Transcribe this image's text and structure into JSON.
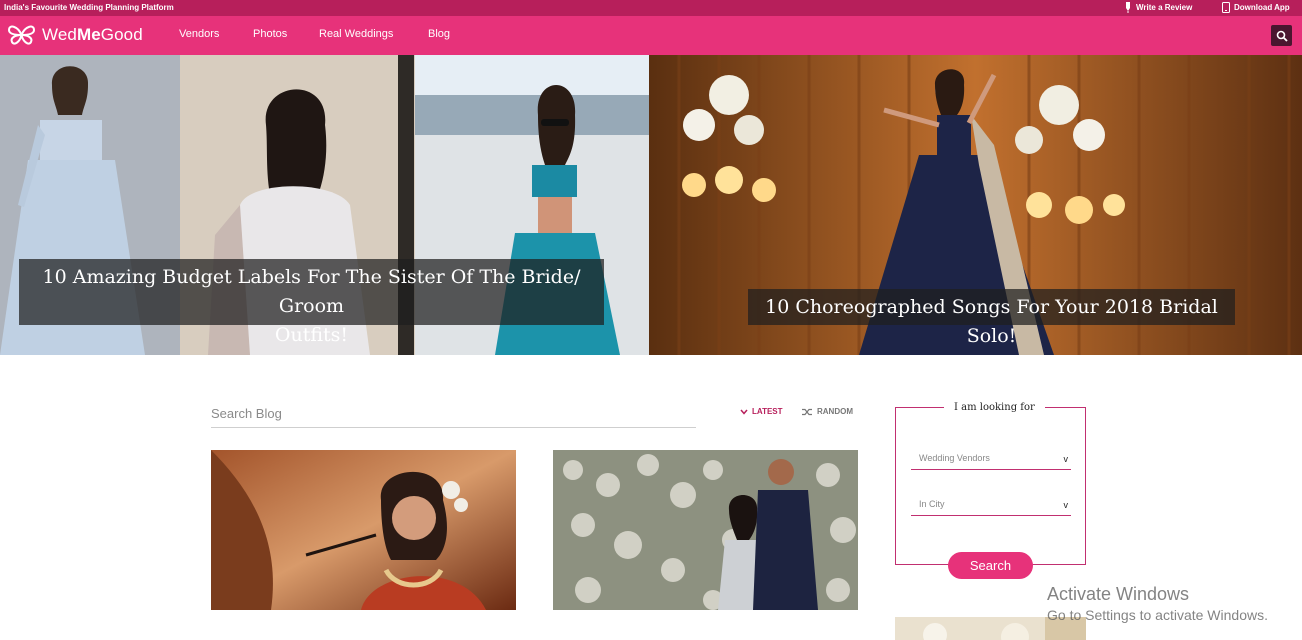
{
  "topbar": {
    "tagline": "India's Favourite Wedding Planning Platform",
    "write_review": "Write a Review",
    "download_app": "Download App"
  },
  "nav": {
    "logo_prefix": "Wed",
    "logo_bold": "Me",
    "logo_suffix": "Good",
    "items": [
      "Vendors",
      "Photos",
      "Real Weddings",
      "Blog"
    ]
  },
  "hero": {
    "left_title_line1": "10 Amazing Budget Labels For The Sister Of The Bride/ Groom",
    "left_title_line2": "Outfits!",
    "right_title": "10 Choreographed Songs For Your 2018 Bridal Solo!"
  },
  "blog": {
    "search_placeholder": "Search Blog",
    "sort_latest": "LATEST",
    "sort_random": "RANDOM"
  },
  "finder": {
    "title": "I am looking for",
    "vendor_select": "Wedding Vendors",
    "city_select": "In City",
    "chevron": "v",
    "search_label": "Search"
  },
  "watermark": {
    "title": "Activate Windows",
    "subtitle": "Go to Settings to activate Windows."
  },
  "colors": {
    "brand_pink": "#e7327a",
    "strip_dark_pink": "#b71f5b",
    "finder_border": "#c12f70"
  },
  "icons": [
    "pen-icon",
    "phone-icon",
    "butterfly-logo-icon",
    "search-icon",
    "chevron-down-icon",
    "shuffle-icon"
  ]
}
